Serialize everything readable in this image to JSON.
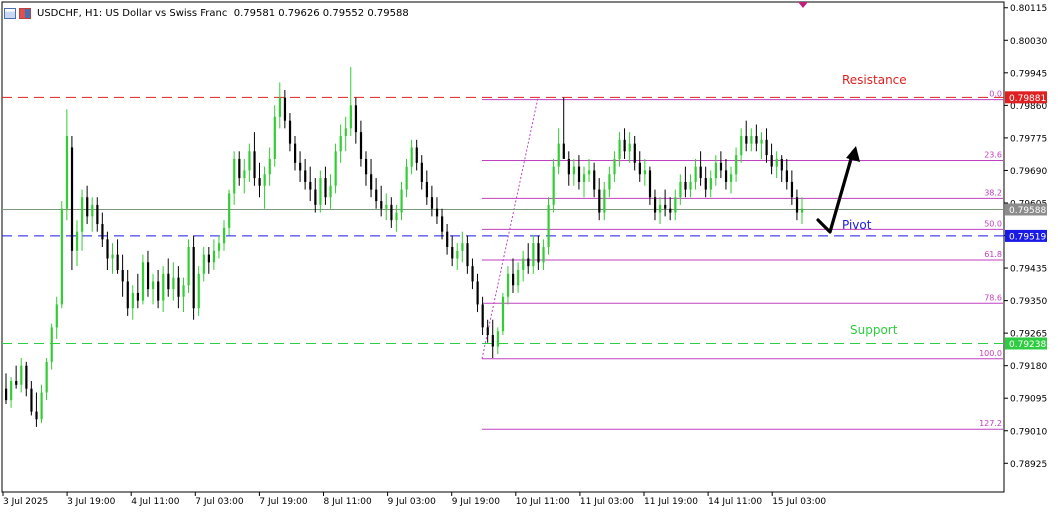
{
  "header": {
    "symbol": "USDCHF, H1:",
    "description": "US Dollar vs Swiss Franc",
    "ohlc": "0.79581 0.79626 0.79552 0.79588"
  },
  "chart_data": {
    "type": "candlestick",
    "instrument": "USDCHF",
    "timeframe": "H1",
    "y_range": [
      0.7885,
      0.8013
    ],
    "y_ticks": [
      "0.80115",
      "0.80030",
      "0.79945",
      "0.79860",
      "0.79775",
      "0.79690",
      "0.79605",
      "0.79520",
      "0.79435",
      "0.79350",
      "0.79265",
      "0.79180",
      "0.79095",
      "0.79010",
      "0.78925"
    ],
    "x_ticks": [
      "3 Jul 2025",
      "3 Jul 19:00",
      "4 Jul 11:00",
      "7 Jul 03:00",
      "7 Jul 19:00",
      "8 Jul 11:00",
      "9 Jul 03:00",
      "9 Jul 19:00",
      "10 Jul 11:00",
      "11 Jul 03:00",
      "11 Jul 19:00",
      "14 Jul 11:00",
      "15 Jul 03:00"
    ],
    "current_price": "0.79588",
    "horizontal_levels": [
      {
        "name": "Resistance",
        "price": 0.79881,
        "price_label": "0.79881",
        "color": "#e02020"
      },
      {
        "name": "Pivot",
        "price": 0.79519,
        "price_label": "0.79519",
        "color": "#1a1ae6"
      },
      {
        "name": "Support",
        "price": 0.79238,
        "price_label": "0.79238",
        "color": "#2ecc40"
      }
    ],
    "fibonacci": {
      "color": "#c040c0",
      "levels": [
        {
          "label": "0.0",
          "price": 0.79875
        },
        {
          "label": "23.6",
          "price": 0.79716
        },
        {
          "label": "38.2",
          "price": 0.79617
        },
        {
          "label": "50.0",
          "price": 0.79536
        },
        {
          "label": "61.8",
          "price": 0.79456
        },
        {
          "label": "78.6",
          "price": 0.79343
        },
        {
          "label": "100.0",
          "price": 0.79198
        },
        {
          "label": "127.2",
          "price": 0.79014
        }
      ]
    },
    "candle_colors": {
      "bull": "#32cd32",
      "bear": "#000000"
    },
    "candles": [
      [
        0.7912,
        0.7916,
        0.7908,
        0.7909
      ],
      [
        0.7909,
        0.7915,
        0.7907,
        0.7914
      ],
      [
        0.7914,
        0.7918,
        0.7912,
        0.7913
      ],
      [
        0.7913,
        0.792,
        0.7911,
        0.7918
      ],
      [
        0.7918,
        0.7919,
        0.791,
        0.7912
      ],
      [
        0.7912,
        0.7914,
        0.7905,
        0.7906
      ],
      [
        0.7906,
        0.7911,
        0.7902,
        0.7904
      ],
      [
        0.7904,
        0.7913,
        0.7903,
        0.7911
      ],
      [
        0.7911,
        0.792,
        0.7909,
        0.7919
      ],
      [
        0.7919,
        0.7929,
        0.7917,
        0.7928
      ],
      [
        0.7928,
        0.7936,
        0.7925,
        0.7934
      ],
      [
        0.7934,
        0.7961,
        0.7933,
        0.7959
      ],
      [
        0.7959,
        0.7985,
        0.7956,
        0.7978
      ],
      [
        0.7975,
        0.7978,
        0.7943,
        0.7948
      ],
      [
        0.7948,
        0.7956,
        0.7944,
        0.7953
      ],
      [
        0.7953,
        0.7964,
        0.7948,
        0.7962
      ],
      [
        0.7962,
        0.7965,
        0.7955,
        0.7957
      ],
      [
        0.7957,
        0.7962,
        0.7953,
        0.796
      ],
      [
        0.796,
        0.7962,
        0.7953,
        0.7955
      ],
      [
        0.7955,
        0.7958,
        0.7949,
        0.7951
      ],
      [
        0.7951,
        0.7953,
        0.7943,
        0.7946
      ],
      [
        0.7946,
        0.795,
        0.7942,
        0.7947
      ],
      [
        0.7947,
        0.7951,
        0.7942,
        0.7943
      ],
      [
        0.7943,
        0.7947,
        0.7936,
        0.794
      ],
      [
        0.794,
        0.7943,
        0.7931,
        0.7933
      ],
      [
        0.7933,
        0.7939,
        0.793,
        0.7937
      ],
      [
        0.7937,
        0.7942,
        0.7933,
        0.7935
      ],
      [
        0.7935,
        0.7947,
        0.7934,
        0.7945
      ],
      [
        0.7945,
        0.7948,
        0.7936,
        0.7938
      ],
      [
        0.7938,
        0.7942,
        0.7934,
        0.794
      ],
      [
        0.794,
        0.7943,
        0.7933,
        0.7935
      ],
      [
        0.7935,
        0.7944,
        0.7932,
        0.7942
      ],
      [
        0.7942,
        0.7946,
        0.7936,
        0.7938
      ],
      [
        0.7938,
        0.7945,
        0.7935,
        0.7941
      ],
      [
        0.7941,
        0.7944,
        0.7933,
        0.7936
      ],
      [
        0.7936,
        0.7941,
        0.7932,
        0.7939
      ],
      [
        0.7939,
        0.7951,
        0.7937,
        0.7949
      ],
      [
        0.7949,
        0.7952,
        0.793,
        0.7933
      ],
      [
        0.7933,
        0.7944,
        0.7931,
        0.7942
      ],
      [
        0.7942,
        0.7949,
        0.794,
        0.7947
      ],
      [
        0.7947,
        0.7949,
        0.7942,
        0.7945
      ],
      [
        0.7945,
        0.7951,
        0.7943,
        0.7948
      ],
      [
        0.7948,
        0.7952,
        0.7946,
        0.795
      ],
      [
        0.795,
        0.7956,
        0.7948,
        0.7954
      ],
      [
        0.7954,
        0.7964,
        0.7952,
        0.7963
      ],
      [
        0.7963,
        0.7974,
        0.796,
        0.7972
      ],
      [
        0.7972,
        0.7974,
        0.7965,
        0.7967
      ],
      [
        0.7967,
        0.7972,
        0.7963,
        0.7969
      ],
      [
        0.7969,
        0.7976,
        0.7966,
        0.7974
      ],
      [
        0.7974,
        0.7979,
        0.7965,
        0.7967
      ],
      [
        0.7967,
        0.7971,
        0.7962,
        0.7965
      ],
      [
        0.7965,
        0.797,
        0.7959,
        0.7968
      ],
      [
        0.7968,
        0.7975,
        0.7965,
        0.7972
      ],
      [
        0.7972,
        0.7986,
        0.797,
        0.7983
      ],
      [
        0.7983,
        0.7992,
        0.798,
        0.7988
      ],
      [
        0.7988,
        0.799,
        0.798,
        0.7982
      ],
      [
        0.7982,
        0.7984,
        0.7974,
        0.7976
      ],
      [
        0.7976,
        0.7978,
        0.7969,
        0.7971
      ],
      [
        0.7971,
        0.7974,
        0.7966,
        0.7969
      ],
      [
        0.7969,
        0.7972,
        0.7964,
        0.7966
      ],
      [
        0.7966,
        0.797,
        0.7961,
        0.7964
      ],
      [
        0.7964,
        0.7967,
        0.7958,
        0.796
      ],
      [
        0.796,
        0.7969,
        0.7958,
        0.7967
      ],
      [
        0.7967,
        0.797,
        0.796,
        0.7962
      ],
      [
        0.7962,
        0.7968,
        0.7959,
        0.7965
      ],
      [
        0.7965,
        0.7976,
        0.7963,
        0.7974
      ],
      [
        0.7974,
        0.7981,
        0.7971,
        0.7978
      ],
      [
        0.7978,
        0.7983,
        0.7974,
        0.798
      ],
      [
        0.798,
        0.7996,
        0.7978,
        0.7986
      ],
      [
        0.7986,
        0.7988,
        0.7976,
        0.7979
      ],
      [
        0.7979,
        0.7982,
        0.797,
        0.7972
      ],
      [
        0.7972,
        0.7974,
        0.7965,
        0.7968
      ],
      [
        0.7968,
        0.7972,
        0.7962,
        0.7964
      ],
      [
        0.7964,
        0.7967,
        0.7959,
        0.7961
      ],
      [
        0.7961,
        0.7965,
        0.7957,
        0.7959
      ],
      [
        0.7959,
        0.7963,
        0.7956,
        0.796
      ],
      [
        0.796,
        0.7962,
        0.7954,
        0.7956
      ],
      [
        0.7956,
        0.796,
        0.7953,
        0.7958
      ],
      [
        0.7958,
        0.7966,
        0.7956,
        0.7964
      ],
      [
        0.7964,
        0.7972,
        0.7962,
        0.797
      ],
      [
        0.797,
        0.7977,
        0.7968,
        0.7975
      ],
      [
        0.7975,
        0.7977,
        0.7969,
        0.7971
      ],
      [
        0.7971,
        0.7973,
        0.7964,
        0.7966
      ],
      [
        0.7966,
        0.7969,
        0.796,
        0.7962
      ],
      [
        0.7962,
        0.7965,
        0.7957,
        0.7959
      ],
      [
        0.7959,
        0.7962,
        0.7955,
        0.7957
      ],
      [
        0.7957,
        0.7959,
        0.7951,
        0.7953
      ],
      [
        0.7953,
        0.7955,
        0.7947,
        0.7949
      ],
      [
        0.7949,
        0.7952,
        0.7944,
        0.7946
      ],
      [
        0.7946,
        0.795,
        0.7943,
        0.7948
      ],
      [
        0.7948,
        0.7953,
        0.7945,
        0.795
      ],
      [
        0.795,
        0.7952,
        0.7942,
        0.7944
      ],
      [
        0.7944,
        0.7946,
        0.7938,
        0.794
      ],
      [
        0.794,
        0.7942,
        0.7932,
        0.7934
      ],
      [
        0.7934,
        0.7936,
        0.7926,
        0.7928
      ],
      [
        0.7928,
        0.793,
        0.7924,
        0.7926
      ],
      [
        0.7926,
        0.793,
        0.792,
        0.7923
      ],
      [
        0.7923,
        0.7928,
        0.7921,
        0.7927
      ],
      [
        0.7927,
        0.7937,
        0.7926,
        0.7936
      ],
      [
        0.7936,
        0.7944,
        0.7934,
        0.7942
      ],
      [
        0.7942,
        0.7946,
        0.7937,
        0.7939
      ],
      [
        0.7939,
        0.7945,
        0.7937,
        0.7943
      ],
      [
        0.7943,
        0.7948,
        0.794,
        0.7946
      ],
      [
        0.7946,
        0.795,
        0.7942,
        0.7944
      ],
      [
        0.7944,
        0.7952,
        0.7942,
        0.795
      ],
      [
        0.795,
        0.7952,
        0.7943,
        0.7945
      ],
      [
        0.7945,
        0.7951,
        0.7943,
        0.7949
      ],
      [
        0.7949,
        0.7962,
        0.7947,
        0.796
      ],
      [
        0.796,
        0.7972,
        0.7958,
        0.797
      ],
      [
        0.797,
        0.798,
        0.7968,
        0.7976
      ],
      [
        0.7976,
        0.7988,
        0.7974,
        0.7972
      ],
      [
        0.7972,
        0.7974,
        0.7965,
        0.7968
      ],
      [
        0.7968,
        0.7972,
        0.7965,
        0.797
      ],
      [
        0.797,
        0.7973,
        0.7964,
        0.7966
      ],
      [
        0.7966,
        0.797,
        0.7962,
        0.7968
      ],
      [
        0.7968,
        0.7972,
        0.7966,
        0.7969
      ],
      [
        0.7969,
        0.7971,
        0.7962,
        0.7964
      ],
      [
        0.7964,
        0.7967,
        0.7956,
        0.7958
      ],
      [
        0.7958,
        0.7966,
        0.7956,
        0.7964
      ],
      [
        0.7964,
        0.797,
        0.7962,
        0.7968
      ],
      [
        0.7968,
        0.7974,
        0.7966,
        0.7972
      ],
      [
        0.7972,
        0.7979,
        0.797,
        0.7977
      ],
      [
        0.7977,
        0.798,
        0.7972,
        0.7974
      ],
      [
        0.7974,
        0.7979,
        0.7971,
        0.7976
      ],
      [
        0.7976,
        0.7978,
        0.7969,
        0.7971
      ],
      [
        0.7971,
        0.7974,
        0.7966,
        0.7968
      ],
      [
        0.7968,
        0.7972,
        0.7965,
        0.7969
      ],
      [
        0.7969,
        0.797,
        0.796,
        0.7962
      ],
      [
        0.7962,
        0.7964,
        0.7956,
        0.7958
      ],
      [
        0.7958,
        0.7962,
        0.7955,
        0.796
      ],
      [
        0.796,
        0.7964,
        0.7957,
        0.7959
      ],
      [
        0.7959,
        0.7962,
        0.7956,
        0.7958
      ],
      [
        0.7958,
        0.7964,
        0.7956,
        0.7962
      ],
      [
        0.7962,
        0.7968,
        0.796,
        0.7966
      ],
      [
        0.7966,
        0.797,
        0.7962,
        0.7964
      ],
      [
        0.7964,
        0.7968,
        0.7962,
        0.7966
      ],
      [
        0.7966,
        0.7972,
        0.7964,
        0.797
      ],
      [
        0.797,
        0.7974,
        0.7965,
        0.7967
      ],
      [
        0.7967,
        0.797,
        0.7962,
        0.7964
      ],
      [
        0.7964,
        0.7969,
        0.7962,
        0.7967
      ],
      [
        0.7967,
        0.7973,
        0.7965,
        0.7971
      ],
      [
        0.7971,
        0.7974,
        0.7967,
        0.7969
      ],
      [
        0.7969,
        0.7972,
        0.7964,
        0.7966
      ],
      [
        0.7966,
        0.797,
        0.7963,
        0.7968
      ],
      [
        0.7968,
        0.7975,
        0.7966,
        0.7973
      ],
      [
        0.7973,
        0.798,
        0.7971,
        0.7978
      ],
      [
        0.7978,
        0.7982,
        0.7974,
        0.7976
      ],
      [
        0.7976,
        0.798,
        0.7974,
        0.7978
      ],
      [
        0.7978,
        0.7981,
        0.7974,
        0.7976
      ],
      [
        0.7976,
        0.7979,
        0.7972,
        0.7977
      ],
      [
        0.7977,
        0.798,
        0.7971,
        0.7973
      ],
      [
        0.7973,
        0.7976,
        0.7968,
        0.797
      ],
      [
        0.797,
        0.7974,
        0.7967,
        0.7972
      ],
      [
        0.7972,
        0.7973,
        0.7966,
        0.7969
      ],
      [
        0.7969,
        0.7972,
        0.7964,
        0.7966
      ],
      [
        0.7966,
        0.7969,
        0.796,
        0.7962
      ],
      [
        0.7962,
        0.7964,
        0.7956,
        0.7958
      ],
      [
        0.7958,
        0.7962,
        0.7955,
        0.7959
      ]
    ],
    "annotations": [
      {
        "text": "Resistance",
        "color": "#e02020"
      },
      {
        "text": "Pivot",
        "color": "#1a1ae6"
      },
      {
        "text": "Support",
        "color": "#2ecc40"
      }
    ]
  }
}
